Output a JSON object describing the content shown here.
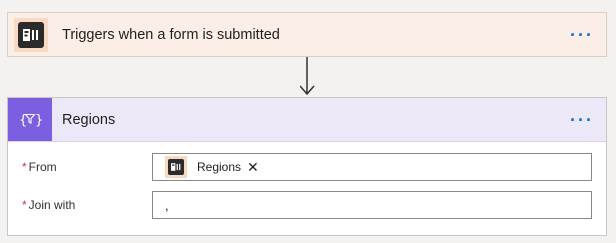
{
  "trigger": {
    "title": "Triggers when a form is submitted",
    "more_label": "···",
    "icon": "forms-icon",
    "colors": {
      "header_bg": "#fbeee6",
      "icon_bg": "#f7d9c4"
    }
  },
  "action": {
    "title": "Regions",
    "more_label": "···",
    "icon": "filter-array-icon",
    "colors": {
      "header_bg": "#ece8f8",
      "icon_bg": "#7b5fe0"
    },
    "fields": {
      "from": {
        "required_mark": "*",
        "label": "From",
        "token": {
          "label": "Regions",
          "icon": "forms-icon",
          "remove": "✕"
        }
      },
      "join_with": {
        "required_mark": "*",
        "label": "Join with",
        "value": ","
      }
    }
  },
  "colors": {
    "accent": "#0b6fd6",
    "required": "#d13438"
  }
}
